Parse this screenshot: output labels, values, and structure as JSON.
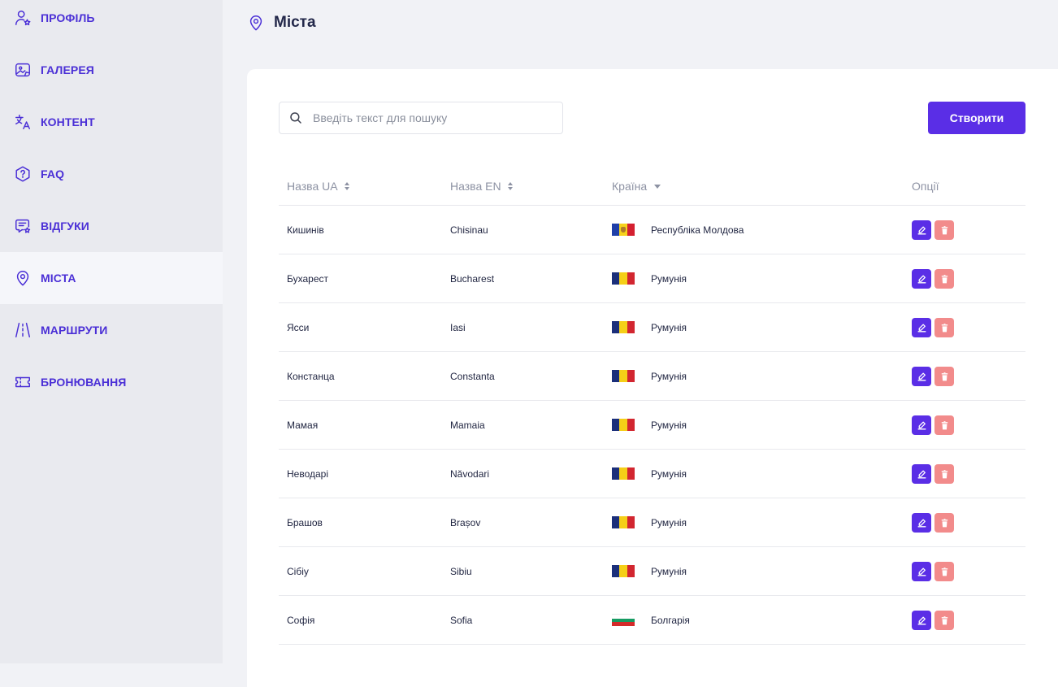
{
  "sidebar": {
    "items": [
      {
        "label": "ПРОФІЛЬ",
        "icon": "user-star-icon",
        "active": false
      },
      {
        "label": "ГАЛЕРЕЯ",
        "icon": "gallery-icon",
        "active": false
      },
      {
        "label": "КОНТЕНТ",
        "icon": "translate-icon",
        "active": false
      },
      {
        "label": "FAQ",
        "icon": "question-hexagon-icon",
        "active": false
      },
      {
        "label": "ВІДГУКИ",
        "icon": "reviews-icon",
        "active": false
      },
      {
        "label": "МІСТА",
        "icon": "map-pin-icon",
        "active": true
      },
      {
        "label": "МАРШРУТИ",
        "icon": "road-icon",
        "active": false
      },
      {
        "label": "БРОНЮВАННЯ",
        "icon": "ticket-icon",
        "active": false
      }
    ]
  },
  "header": {
    "title": "Міста",
    "icon": "map-pin-icon"
  },
  "search": {
    "placeholder": "Введіть текст для пошуку",
    "value": ""
  },
  "toolbar": {
    "create_label": "Створити"
  },
  "table": {
    "columns": [
      "Назва UA",
      "Назва EN",
      "Країна",
      "Опції"
    ],
    "rows": [
      {
        "name_ua": "Кишинів",
        "name_en": "Chisinau",
        "country": "Республіка Молдова",
        "flag": "md"
      },
      {
        "name_ua": "Бухарест",
        "name_en": "Bucharest",
        "country": "Румунія",
        "flag": "ro"
      },
      {
        "name_ua": "Ясси",
        "name_en": "Iasi",
        "country": "Румунія",
        "flag": "ro"
      },
      {
        "name_ua": "Констанца",
        "name_en": "Constanta",
        "country": "Румунія",
        "flag": "ro"
      },
      {
        "name_ua": "Мамая",
        "name_en": "Mamaia",
        "country": "Румунія",
        "flag": "ro"
      },
      {
        "name_ua": "Неводарі",
        "name_en": "Năvodari",
        "country": "Румунія",
        "flag": "ro"
      },
      {
        "name_ua": "Брашов",
        "name_en": "Brașov",
        "country": "Румунія",
        "flag": "ro"
      },
      {
        "name_ua": "Сібіу",
        "name_en": "Sibiu",
        "country": "Румунія",
        "flag": "ro"
      },
      {
        "name_ua": "Софія",
        "name_en": "Sofia",
        "country": "Болгарія",
        "flag": "bg"
      }
    ]
  },
  "colors": {
    "accent": "#5a2ee6",
    "nav_text": "#4a2fd6",
    "delete": "#f28b8b",
    "sidebar_bg": "#e9eaef"
  }
}
